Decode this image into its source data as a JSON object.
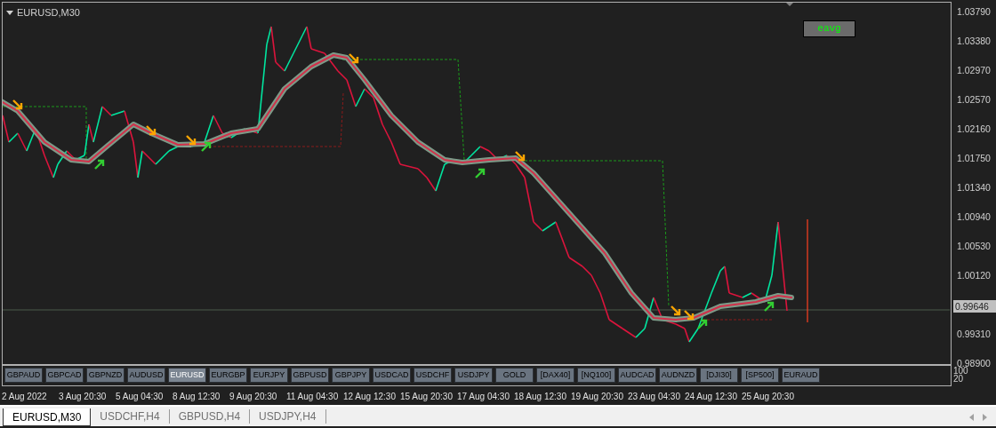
{
  "chart": {
    "title": "EURUSD,M30",
    "indicator_button": "eavg",
    "price_axis": [
      "1.03790",
      "1.03380",
      "1.02970",
      "1.02570",
      "1.02160",
      "1.01750",
      "1.01340",
      "1.00940",
      "1.00530",
      "1.00120",
      "0.99310",
      "0.98900"
    ],
    "current_price": "0.99646"
  },
  "symbol_buttons": [
    {
      "label": "GBPAUD",
      "selected": false
    },
    {
      "label": "GBPCAD",
      "selected": false
    },
    {
      "label": "GBPNZD",
      "selected": false
    },
    {
      "label": "AUDUSD",
      "selected": false
    },
    {
      "label": "EURUSD",
      "selected": true
    },
    {
      "label": "EURGBP",
      "selected": false
    },
    {
      "label": "EURJPY",
      "selected": false
    },
    {
      "label": "GBPUSD",
      "selected": false
    },
    {
      "label": "GBPJPY",
      "selected": false
    },
    {
      "label": "USDCAD",
      "selected": false
    },
    {
      "label": "USDCHF",
      "selected": false
    },
    {
      "label": "USDJPY",
      "selected": false
    },
    {
      "label": "GOLD",
      "selected": false
    },
    {
      "label": "[DAX40]",
      "selected": false
    },
    {
      "label": "[NQ100]",
      "selected": false
    },
    {
      "label": "AUDCAD",
      "selected": false
    },
    {
      "label": "AUDNZD",
      "selected": false
    },
    {
      "label": "[DJI30]",
      "selected": false
    },
    {
      "label": "[SP500]",
      "selected": false
    },
    {
      "label": "EURAUD",
      "selected": false
    }
  ],
  "indicator_scale": [
    "100",
    "20"
  ],
  "time_axis": [
    "2 Aug 2022",
    "3 Aug 20:30",
    "5 Aug 04:30",
    "8 Aug 12:30",
    "9 Aug 20:30",
    "11 Aug 04:30",
    "12 Aug 12:30",
    "15 Aug 20:30",
    "17 Aug 04:30",
    "18 Aug 12:30",
    "19 Aug 20:30",
    "23 Aug 04:30",
    "24 Aug 12:30",
    "25 Aug 20:30"
  ],
  "tabs": [
    {
      "label": "EURUSD,M30",
      "selected": true
    },
    {
      "label": "USDCHF,H4",
      "selected": false
    },
    {
      "label": "GBPUSD,H4",
      "selected": false
    },
    {
      "label": "USDJPY,H4",
      "selected": false
    }
  ]
}
